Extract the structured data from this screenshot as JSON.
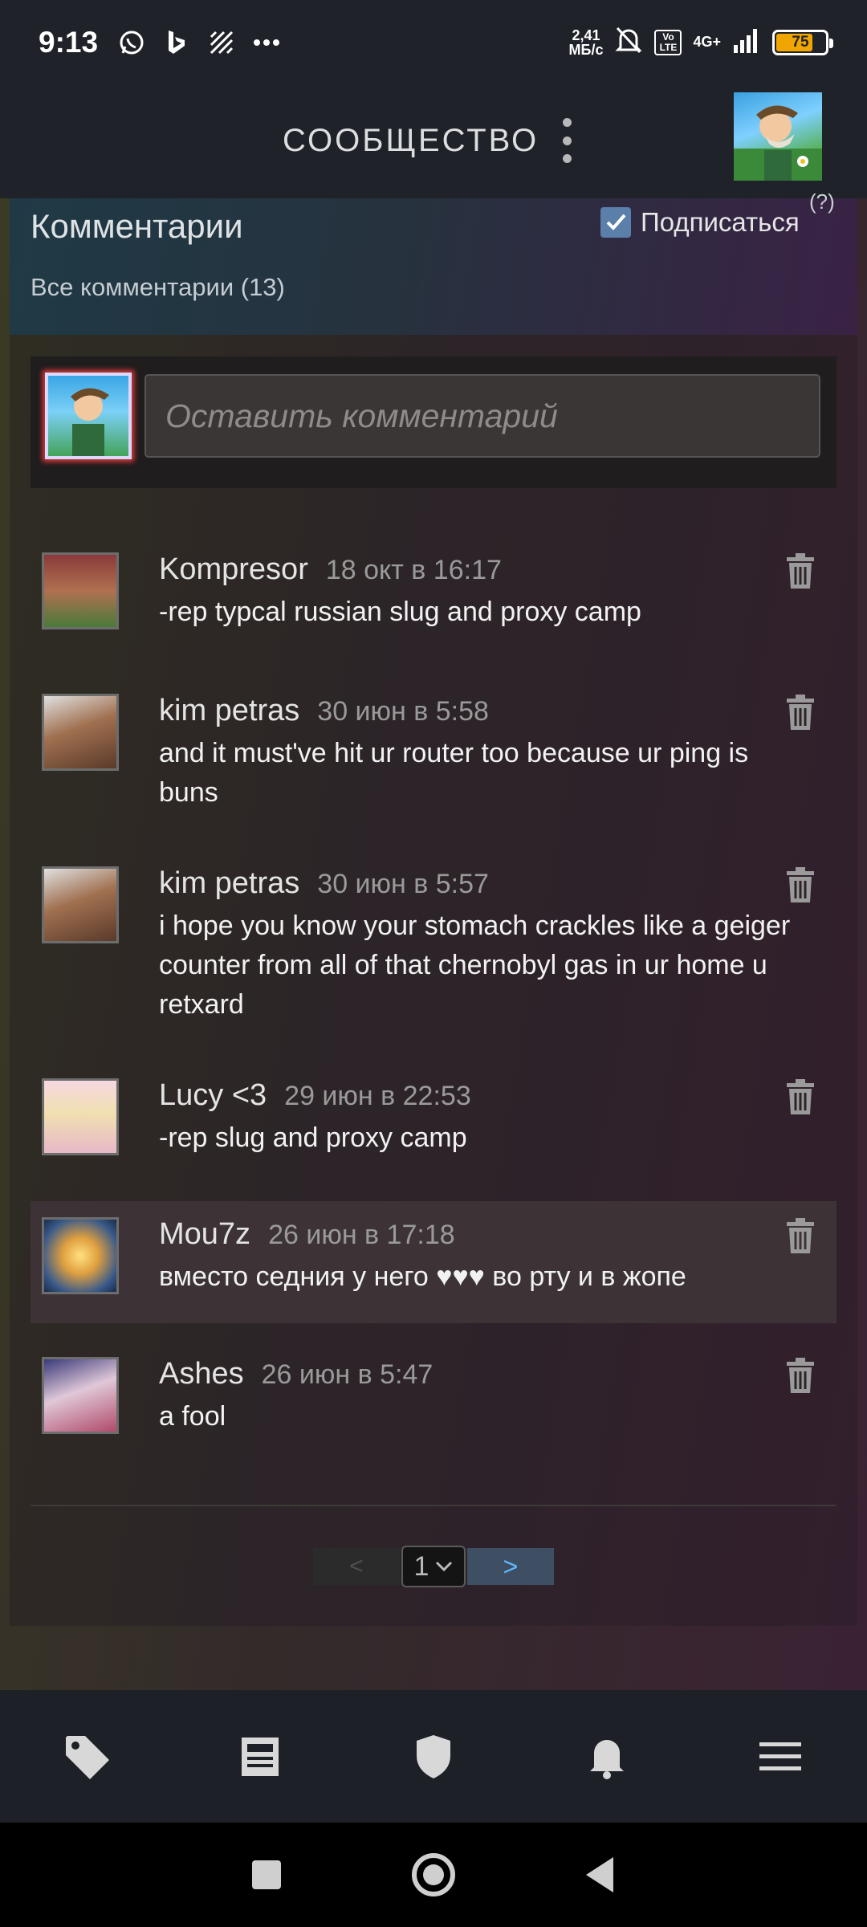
{
  "status_bar": {
    "time": "9:13",
    "net_speed_value": "2,41",
    "net_speed_unit": "МБ/с",
    "volte": "Vo LTE",
    "network": "4G+",
    "battery": "75",
    "battery_level": 0.75
  },
  "header": {
    "title": "СООБЩЕСТВО"
  },
  "comments_panel": {
    "title": "Комментарии",
    "subscribe_label": "Подписаться",
    "subscribed": true,
    "help": "(?)",
    "all_comments": "Все комментарии (13)",
    "input_placeholder": "Оставить комментарий"
  },
  "comments": [
    {
      "author": "Kompresor",
      "time": "18 окт в 16:17",
      "text": "-rep typcal russian slug and proxy camp",
      "avatar": "avatar-kompresor"
    },
    {
      "author": "kim petras",
      "time": "30 июн в 5:58",
      "text": "and it must've hit ur router too because ur ping is buns",
      "avatar": "avatar-kim-petras"
    },
    {
      "author": "kim petras",
      "time": "30 июн в 5:57",
      "text": "i hope you know your stomach crackles like a geiger counter from all of that chernobyl gas in ur home u retxard",
      "avatar": "avatar-kim-petras"
    },
    {
      "author": "Lucy <3",
      "time": "29 июн в 22:53",
      "text": "-rep slug and proxy camp",
      "avatar": "avatar-lucy"
    },
    {
      "author": "Mou7z",
      "time": "26 июн в 17:18",
      "text": "вместо седния у него ♥♥♥ во рту и в жопе",
      "avatar": "avatar-mou7z"
    },
    {
      "author": "Ashes",
      "time": "26 июн в 5:47",
      "text": "a fool",
      "avatar": "avatar-ashes"
    }
  ],
  "pagination": {
    "prev": "<",
    "page": "1",
    "next": ">"
  },
  "bottom_nav": [
    "tag-icon",
    "news-icon",
    "shield-icon",
    "bell-icon",
    "menu-icon"
  ],
  "colors": {
    "accent": "#5fb8ff",
    "checkbox": "#5a7fa8",
    "battery": "#f0a500"
  }
}
